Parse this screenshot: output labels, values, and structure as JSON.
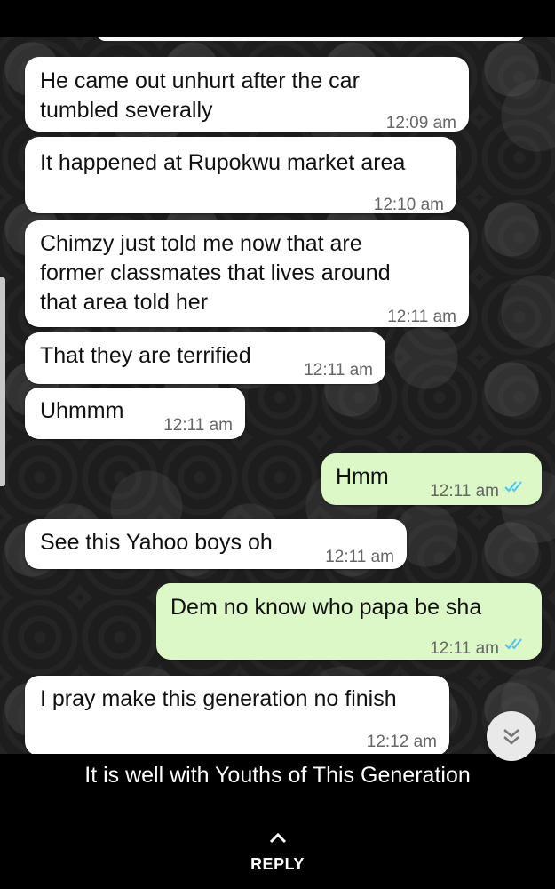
{
  "messages": [
    {
      "lines": [
        "He came out unhurt after the car",
        "tumbled severally"
      ],
      "time": "12:09 am",
      "outgoing": false
    },
    {
      "lines": [
        "It happened at Rupokwu market area"
      ],
      "time": "12:10 am",
      "outgoing": false
    },
    {
      "lines": [
        "Chimzy just told me now that are",
        "former classmates that lives around",
        "that area told her"
      ],
      "time": "12:11 am",
      "outgoing": false
    },
    {
      "lines": [
        "That they are terrified"
      ],
      "time": "12:11 am",
      "outgoing": false
    },
    {
      "lines": [
        "Uhmmm"
      ],
      "time": "12:11 am",
      "outgoing": false
    },
    {
      "lines": [
        "Hmm"
      ],
      "time": "12:11 am",
      "outgoing": true,
      "status": "read"
    },
    {
      "lines": [
        "See this Yahoo boys oh"
      ],
      "time": "12:11 am",
      "outgoing": false
    },
    {
      "lines": [
        "Dem no know who papa be sha"
      ],
      "time": "12:11 am",
      "outgoing": true,
      "status": "read"
    },
    {
      "lines": [
        "I pray make this generation no finish"
      ],
      "time": "12:12 am",
      "outgoing": false
    }
  ],
  "caption": "It is well with Youths of This Generation",
  "reply": {
    "label": "REPLY",
    "icon": "chevron-up-icon"
  },
  "scroll_button": {
    "icon": "double-chevron-down-icon"
  },
  "colors": {
    "incoming_bubble": "#ffffff",
    "outgoing_bubble": "#dcf8c6",
    "read_ticks": "#4fc3f7",
    "time_text": "#666666",
    "page_background": "#000000"
  }
}
